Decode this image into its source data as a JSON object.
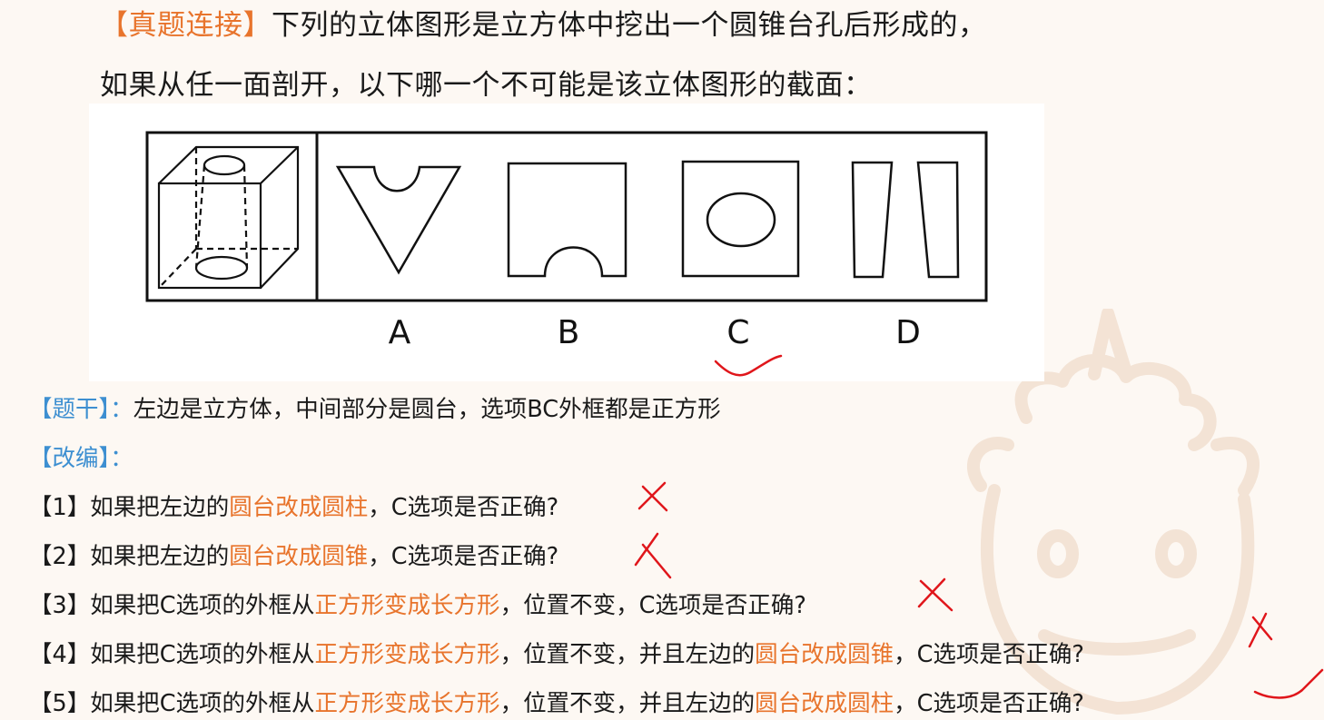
{
  "title": {
    "tag": "【真题连接】",
    "line1_rest": "下列的立体图形是立方体中挖出一个圆锥台孔后形成的，",
    "line2": "如果从任一面剖开，以下哪一个不可能是该立体图形的截面："
  },
  "figure": {
    "options": [
      "A",
      "B",
      "C",
      "D"
    ]
  },
  "stem": {
    "label": "【题干】：",
    "text": "左边是立方体，中间部分是圆台，选项BC外框都是正方形"
  },
  "adapt": {
    "label": "【改编】："
  },
  "questions": [
    {
      "num": "【1】",
      "a": "如果把左边的",
      "b": "圆台改成圆柱",
      "c": "，C选项是否正确?",
      "d": "",
      "e": "",
      "f": ""
    },
    {
      "num": "【2】",
      "a": "如果把左边的",
      "b": "圆台改成圆锥",
      "c": "，C选项是否正确?",
      "d": "",
      "e": "",
      "f": ""
    },
    {
      "num": "【3】",
      "a": "如果把C选项的外框从",
      "b": "正方形变成长方形",
      "c": "，位置不变，C选项是否正确?",
      "d": "",
      "e": "",
      "f": ""
    },
    {
      "num": "【4】",
      "a": "如果把C选项的外框从",
      "b": "正方形变成长方形",
      "c": "，位置不变，并且左边的",
      "d": "圆台改成圆锥",
      "e": "，C选项是否正确?",
      "f": ""
    },
    {
      "num": "【5】",
      "a": "如果把C选项的外框从",
      "b": "正方形变成长方形",
      "c": "，位置不变，并且左边的",
      "d": "圆台改成圆柱",
      "e": "，C选项是否正确?",
      "f": ""
    }
  ],
  "colors": {
    "accent_orange": "#e8742c",
    "label_blue": "#3d8fd1",
    "annotation_red": "#e0161b",
    "background": "#fdf8f3"
  },
  "icons": {
    "watermark": "unicorn-mascot-watermark",
    "marks": [
      "cross-mark",
      "check-mark"
    ]
  }
}
